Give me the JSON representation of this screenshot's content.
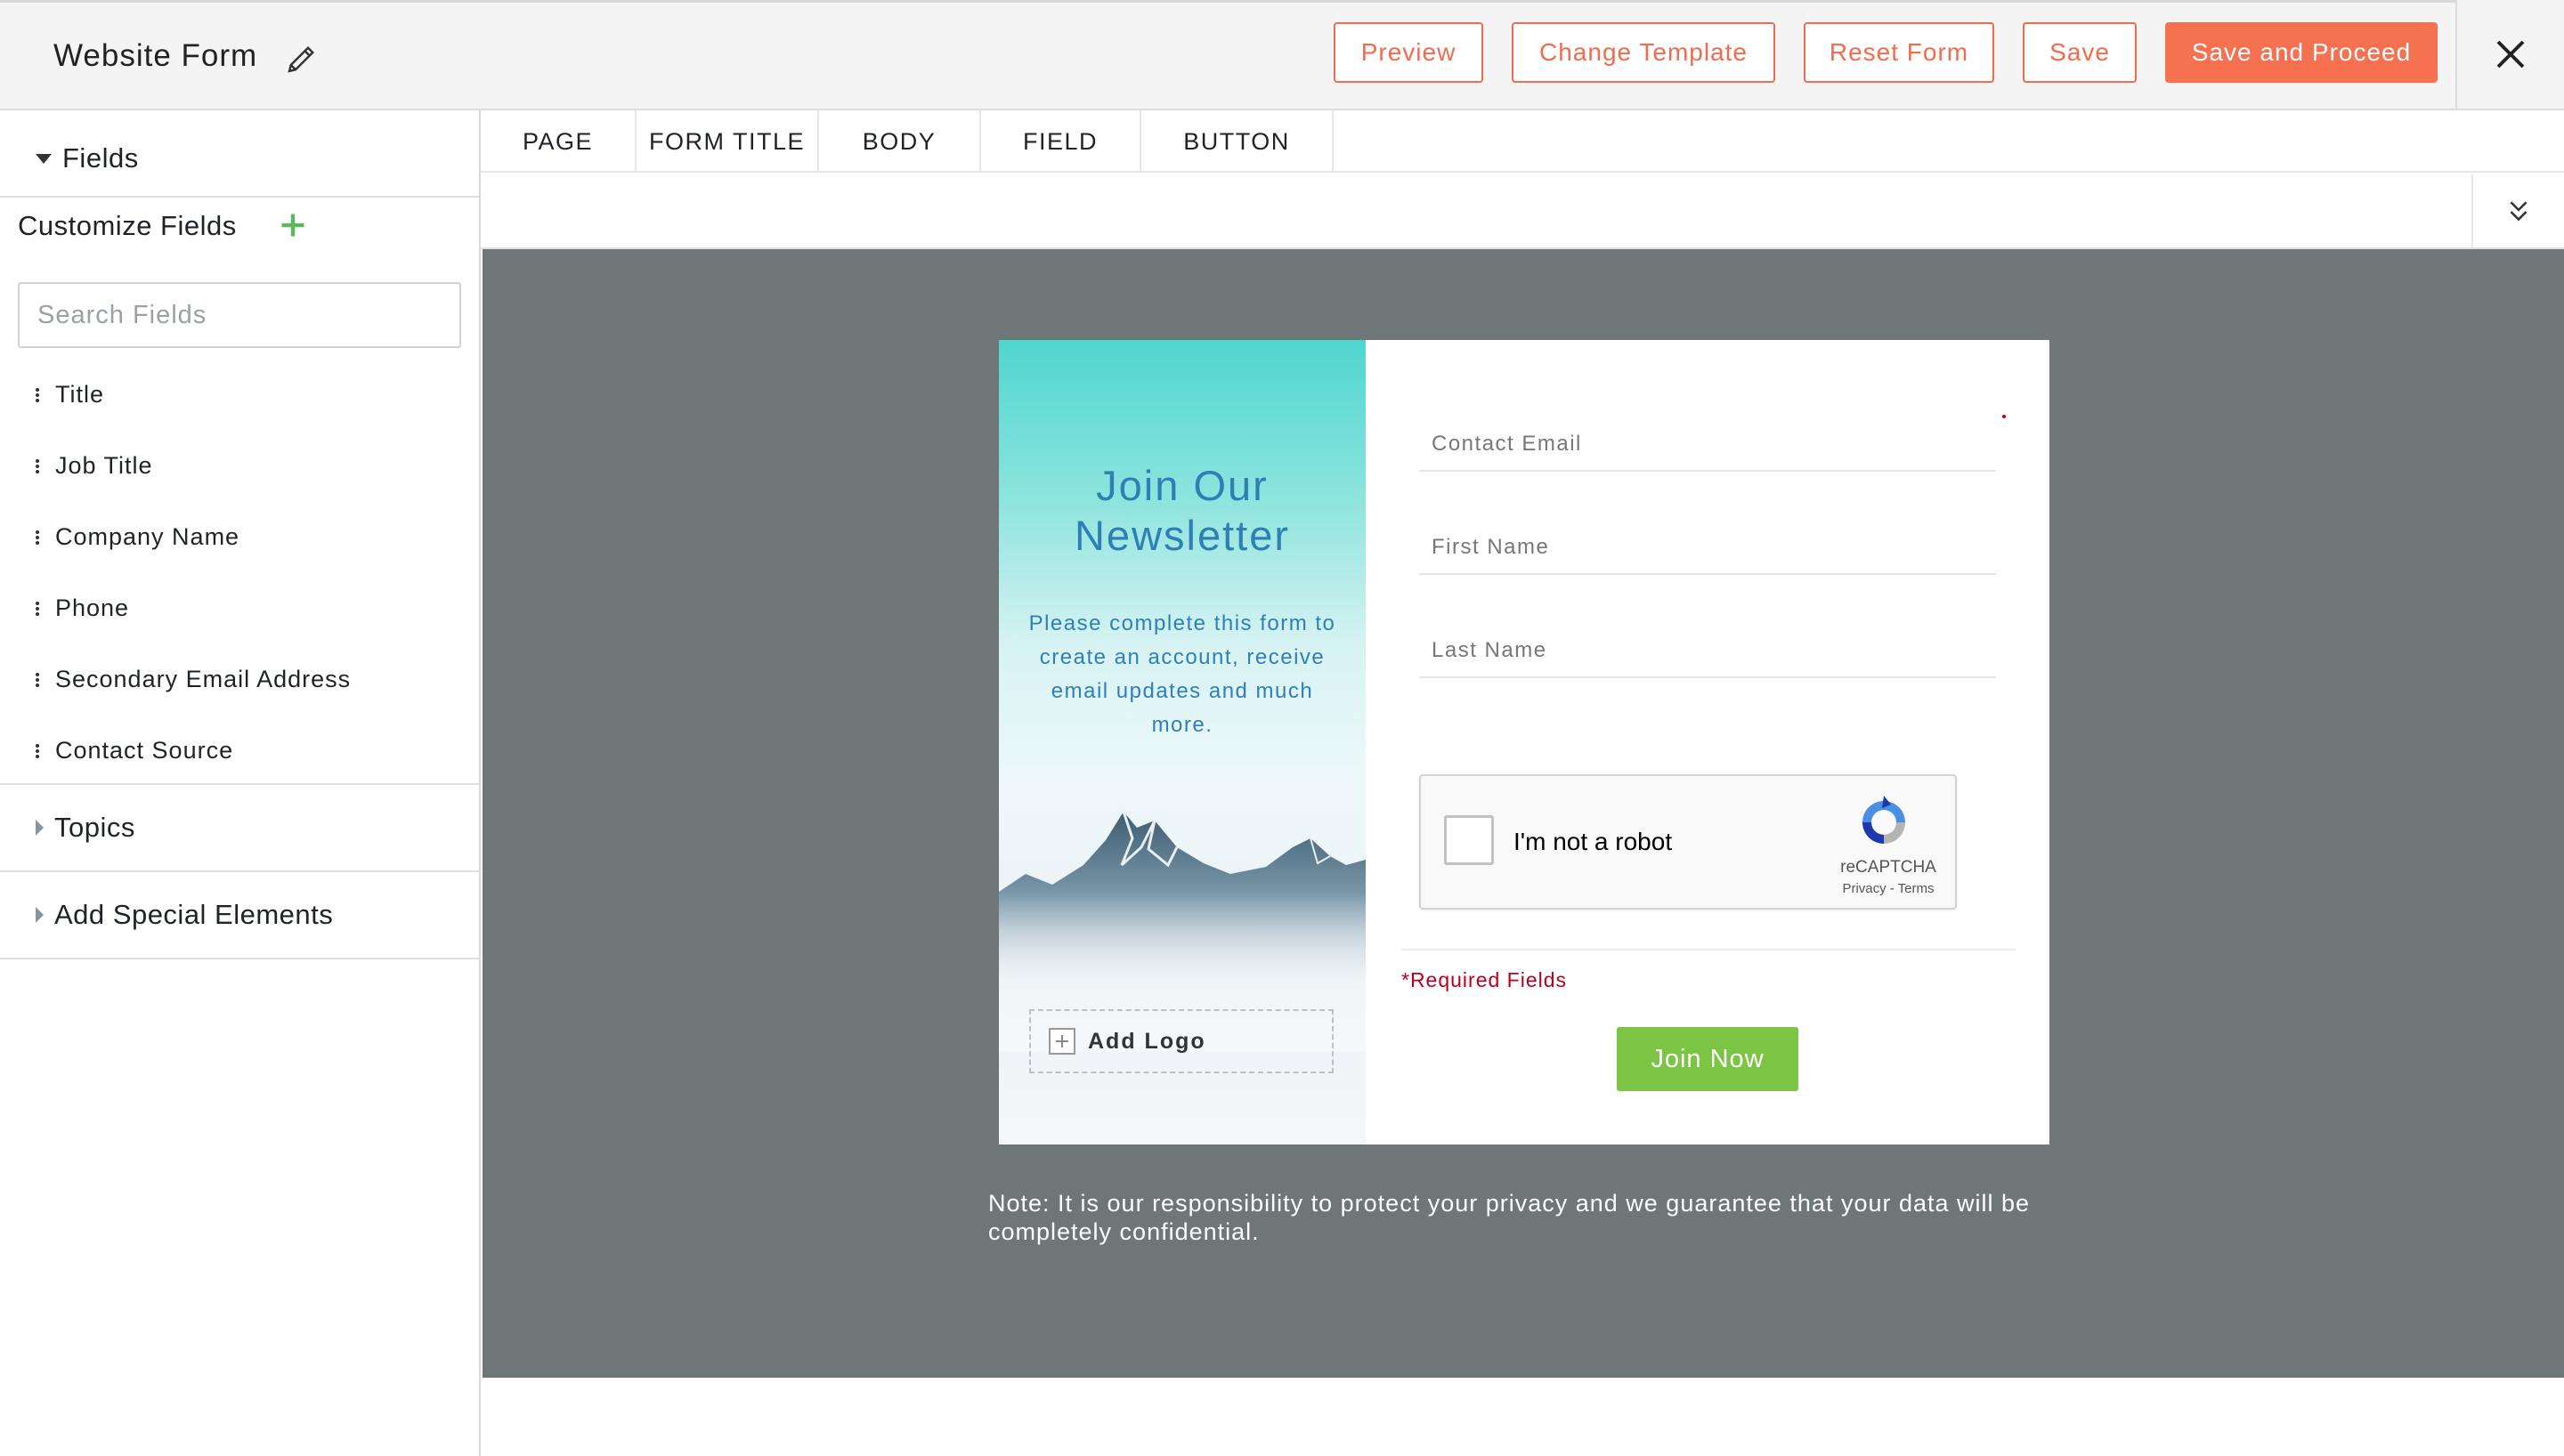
{
  "header": {
    "title": "Website Form",
    "buttons": {
      "preview": "Preview",
      "change_template": "Change Template",
      "reset_form": "Reset Form",
      "save": "Save",
      "save_proceed": "Save and Proceed"
    },
    "accent_color": "#f26b4f"
  },
  "sidebar": {
    "fields_section": "Fields",
    "customize_label": "Customize Fields",
    "search_placeholder": "Search Fields",
    "field_items": [
      "Title",
      "Job Title",
      "Company Name",
      "Phone",
      "Secondary Email Address",
      "Contact Source"
    ],
    "topics_section": "Topics",
    "special_section": "Add Special Elements"
  },
  "tabs": [
    "PAGE",
    "FORM TITLE",
    "BODY",
    "FIELD",
    "BUTTON"
  ],
  "form": {
    "hero_title": "Join Our Newsletter",
    "hero_subtitle": "Please complete this form to create an account, receive email updates and much more.",
    "add_logo": "Add Logo",
    "inputs": {
      "email": "Contact Email",
      "first_name": "First Name",
      "last_name": "Last Name"
    },
    "recaptcha": {
      "label": "I'm not a robot",
      "brand": "reCAPTCHA",
      "links": "Privacy - Terms"
    },
    "required_note": "*Required Fields",
    "submit": "Join Now",
    "submit_color": "#7cc544"
  },
  "note": "Note: It is our responsibility to protect your privacy and we guarantee that your data will be completely confidential."
}
